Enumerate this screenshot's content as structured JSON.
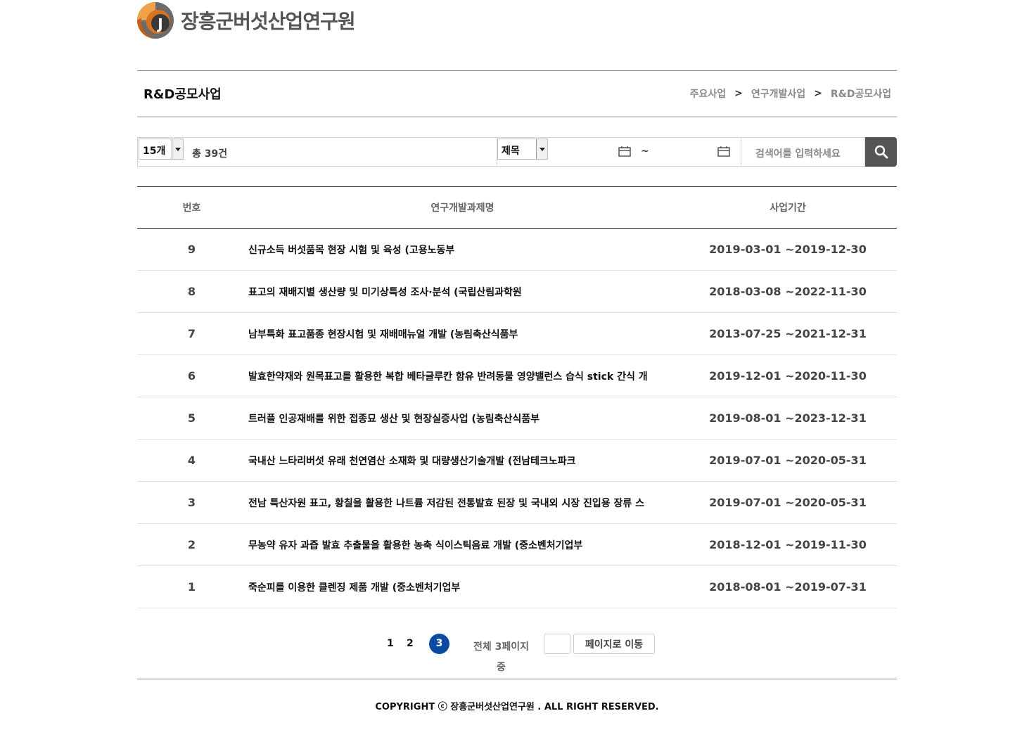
{
  "brand": {
    "name": "장흥군버섯산업연구원",
    "logo_letter": "J"
  },
  "page": {
    "title": "R&D공모사업",
    "breadcrumb": [
      "주요사업",
      "연구개발사업",
      "R&D공모사업"
    ]
  },
  "search": {
    "per_page": "15개",
    "total": "총 39건",
    "field": "제목",
    "tilde": "~",
    "placeholder": "검색어를 입력하세요"
  },
  "table": {
    "headers": {
      "no": "번호",
      "title": "연구개발과제명",
      "period": "사업기간"
    },
    "rows": [
      {
        "no": "9",
        "title": "신규소득 버섯품목 현장 시험 및 육성 (고용노동부",
        "period": "2019-03-01 ~2019-12-30"
      },
      {
        "no": "8",
        "title": "표고의 재배지별 생산량 및 미기상특성 조사·분석 (국립산림과학원",
        "period": "2018-03-08 ~2022-11-30"
      },
      {
        "no": "7",
        "title": "남부특화 표고품종 현장시험 및 재배매뉴얼 개발 (농림축산식품부",
        "period": "2013-07-25 ~2021-12-31"
      },
      {
        "no": "6",
        "title": "발효한약재와 원목표고를 활용한 복합 베타글루칸 함유 반려동물 영양밸런스 습식 stick 간식 개",
        "period": "2019-12-01 ~2020-11-30"
      },
      {
        "no": "5",
        "title": "트러플 인공재배를 위한 접종묘 생산 및 현장실증사업 (농림축산식품부",
        "period": "2019-08-01 ~2023-12-31"
      },
      {
        "no": "4",
        "title": "국내산 느타리버섯 유래 천연염산 소재화 및 대량생산기술개발 (전남테크노파크",
        "period": "2019-07-01 ~2020-05-31"
      },
      {
        "no": "3",
        "title": "전남 특산자원 표고, 황칠을 활용한 나트륨 저감된 전통발효 된장 및 국내외 시장 진입용 장류 스",
        "period": "2019-07-01 ~2020-05-31"
      },
      {
        "no": "2",
        "title": "무농약 유자 과즙 발효 추출물을 활용한 농축 식이스틱음료 개발 (중소벤처기업부",
        "period": "2018-12-01 ~2019-11-30"
      },
      {
        "no": "1",
        "title": "죽순피를 이용한 클렌징 제품 개발 (중소벤처기업부",
        "period": "2018-08-01 ~2019-07-31"
      }
    ]
  },
  "pagination": {
    "pages": [
      "1",
      "2"
    ],
    "current": "3",
    "total_text": "전체 3페이지 중",
    "go_label": "페이지로 이동"
  },
  "footer": {
    "copyright": "COPYRIGHT ⓒ 장흥군버섯산업연구원 . ALL RIGHT RESERVED."
  },
  "colors": {
    "accent": "#0b4aa2",
    "search_button": "#555555",
    "logo_orange": "#d9731f"
  },
  "icons": {
    "calendar": "calendar-icon",
    "search": "search-icon"
  }
}
